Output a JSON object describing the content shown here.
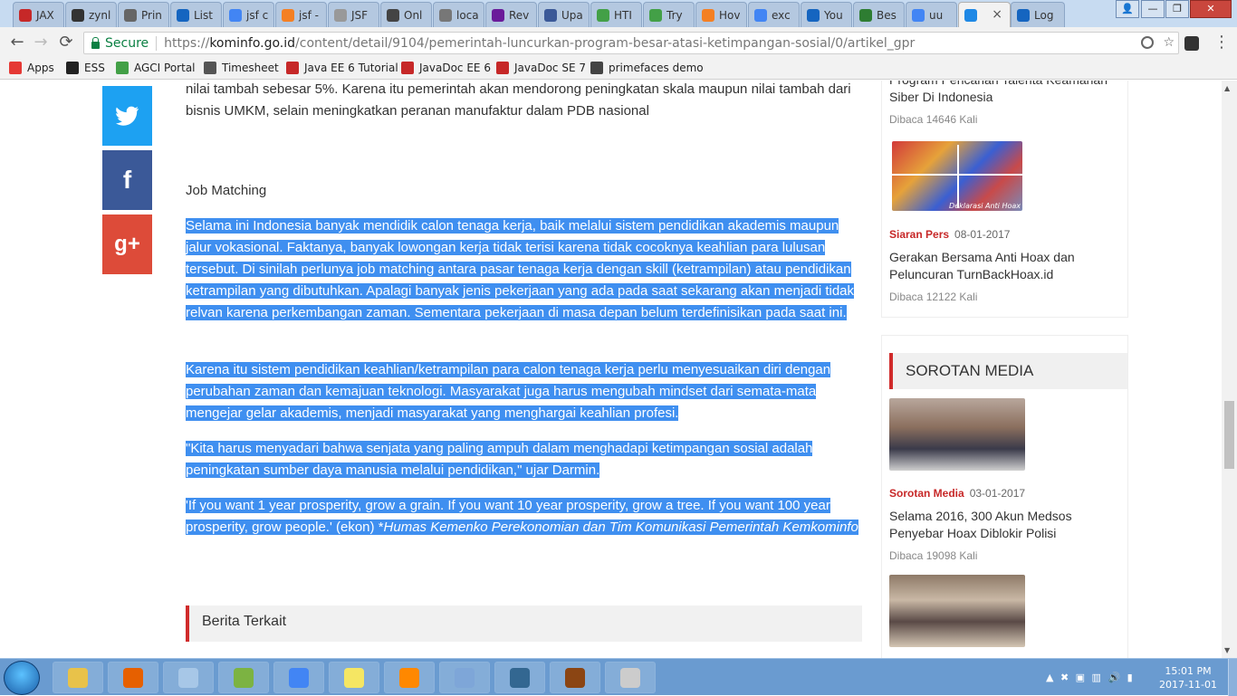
{
  "browser": {
    "tabs": [
      {
        "label": "JAX",
        "color": "#c62828"
      },
      {
        "label": "zynl",
        "color": "#333333"
      },
      {
        "label": "Prin",
        "color": "#666666"
      },
      {
        "label": "List",
        "color": "#1565c0"
      },
      {
        "label": "jsf c",
        "color": "#4285f4"
      },
      {
        "label": "jsf -",
        "color": "#f48024"
      },
      {
        "label": "JSF",
        "color": "#999999"
      },
      {
        "label": "Onl",
        "color": "#444444"
      },
      {
        "label": "loca",
        "color": "#777777"
      },
      {
        "label": "Rev",
        "color": "#6a1b9a"
      },
      {
        "label": "Upa",
        "color": "#3b5998"
      },
      {
        "label": "HTI",
        "color": "#43a047"
      },
      {
        "label": "Try",
        "color": "#43a047"
      },
      {
        "label": "Hov",
        "color": "#f48024"
      },
      {
        "label": "exc",
        "color": "#4285f4"
      },
      {
        "label": "You",
        "color": "#1565c0"
      },
      {
        "label": "Bes",
        "color": "#2e7d32"
      },
      {
        "label": "uu",
        "color": "#4285f4"
      },
      {
        "label": "",
        "color": "#1e88e5"
      },
      {
        "label": "Log",
        "color": "#1565c0"
      }
    ],
    "active_tab_close": "×",
    "window_controls": {
      "user": "👤",
      "minimize": "—",
      "maximize": "❐",
      "close": "✕"
    },
    "nav": {
      "back": "←",
      "forward": "→",
      "reload": "⟳"
    },
    "address": {
      "secure_label": "Secure",
      "scheme": "https://",
      "host": "kominfo.go.id",
      "path": "/content/detail/9104/pemerintah-luncurkan-program-besar-atasi-ketimpangan-sosial/0/artikel_gpr"
    },
    "bookmarks": [
      {
        "label": "Apps",
        "icon": "apps-grid-icon",
        "color": "#e53935"
      },
      {
        "label": "ESS",
        "icon": "ess-icon",
        "color": "#222222"
      },
      {
        "label": "AGCI Portal",
        "icon": "agci-icon",
        "color": "#43a047"
      },
      {
        "label": "Timesheet",
        "icon": "timesheet-icon",
        "color": "#555555"
      },
      {
        "label": "Java EE 6 Tutorial",
        "icon": "oracle-icon",
        "color": "#c62828"
      },
      {
        "label": "JavaDoc EE 6",
        "icon": "oracle-icon",
        "color": "#c62828"
      },
      {
        "label": "JavaDoc SE 7",
        "icon": "oracle-icon",
        "color": "#c62828"
      },
      {
        "label": "primefaces demo",
        "icon": "primefaces-icon",
        "color": "#444444"
      }
    ]
  },
  "social": [
    {
      "name": "twitter",
      "glyph": "t",
      "color": "#1da1f2"
    },
    {
      "name": "facebook",
      "glyph": "f",
      "color": "#3b5998"
    },
    {
      "name": "googleplus",
      "glyph": "g+",
      "color": "#dd4b39"
    }
  ],
  "article": {
    "top_paragraph": "nilai tambah sebesar 5%. Karena itu pemerintah akan mendorong peningkatan skala maupun nilai tambah dari bisnis UMKM, selain meningkatkan peranan manufaktur dalam PDB nasional",
    "subheading": "Job Matching",
    "p1": "Selama ini Indonesia banyak mendidik calon tenaga kerja, baik melalui sistem pendidikan akademis maupun jalur vokasional. Faktanya, banyak lowongan kerja tidak terisi karena tidak cocoknya keahlian para lulusan tersebut. Di sinilah perlunya job matching antara pasar tenaga kerja dengan skill (ketrampilan) atau pendidikan ketrampilan yang dibutuhkan. Apalagi banyak jenis pekerjaan yang ada pada saat sekarang akan menjadi tidak relvan karena perkembangan zaman. Sementara pekerjaan di masa depan belum terdefinisikan pada saat ini.",
    "p2": "Karena itu sistem pendidikan keahlian/ketrampilan para calon tenaga kerja perlu menyesuaikan diri dengan perubahan zaman dan kemajuan teknologi. Masyarakat juga harus mengubah mindset dari semata-mata mengejar gelar akademis, menjadi masyarakat yang menghargai keahlian profesi.",
    "p3": "\"Kita harus menyadari bahwa senjata yang paling ampuh dalam menghadapi ketimpangan sosial adalah peningkatan sumber daya manusia melalui pendidikan,\" ujar Darmin.",
    "p4_plain": "'If you want 1 year prosperity, grow a grain. If you want 10 year prosperity, grow a tree. If you want 100 year prosperity, grow people.' (ekon) *",
    "p4_italic": "Humas Kemenko Perekonomian dan Tim Komunikasi Pemerintah Kemkominfo",
    "related_heading": "Berita Terkait"
  },
  "sidebar": {
    "item0": {
      "title": "Program Pencarian Talenta Keamanan Siber Di Indonesia",
      "meta": "Dibaca 14646 Kali"
    },
    "item1": {
      "category": "Siaran Pers",
      "date": "08-01-2017",
      "title": "Gerakan Bersama Anti Hoax dan Peluncuran TurnBackHoax.id",
      "meta": "Dibaca 12122 Kali",
      "image_caption": "Deklarasi Anti Hoax"
    },
    "section_title": "SOROTAN MEDIA",
    "item2": {
      "category": "Sorotan Media",
      "date": "03-01-2017",
      "title": "Selama 2016, 300 Akun Medsos Penyebar Hoax Diblokir Polisi",
      "meta": "Dibaca 19098 Kali"
    }
  },
  "taskbar": {
    "apps": [
      "explorer-icon",
      "firefox-icon",
      "notepad-icon",
      "editor-icon",
      "chrome-icon",
      "sticky-notes-icon",
      "vlc-icon",
      "photo-icon",
      "postgres-icon",
      "java-ee-ide-icon",
      "paint-icon"
    ],
    "app_colors": [
      "#e8c24a",
      "#e66000",
      "#a7c7e7",
      "#7cb342",
      "#4285f4",
      "#f5e663",
      "#ff8800",
      "#7ea6d8",
      "#336791",
      "#8b4513",
      "#cccccc"
    ],
    "tray_icons": "▲  ✖  ▣  ▥  🔊  ▮",
    "time": "15:01 PM",
    "date": "2017-11-01"
  }
}
